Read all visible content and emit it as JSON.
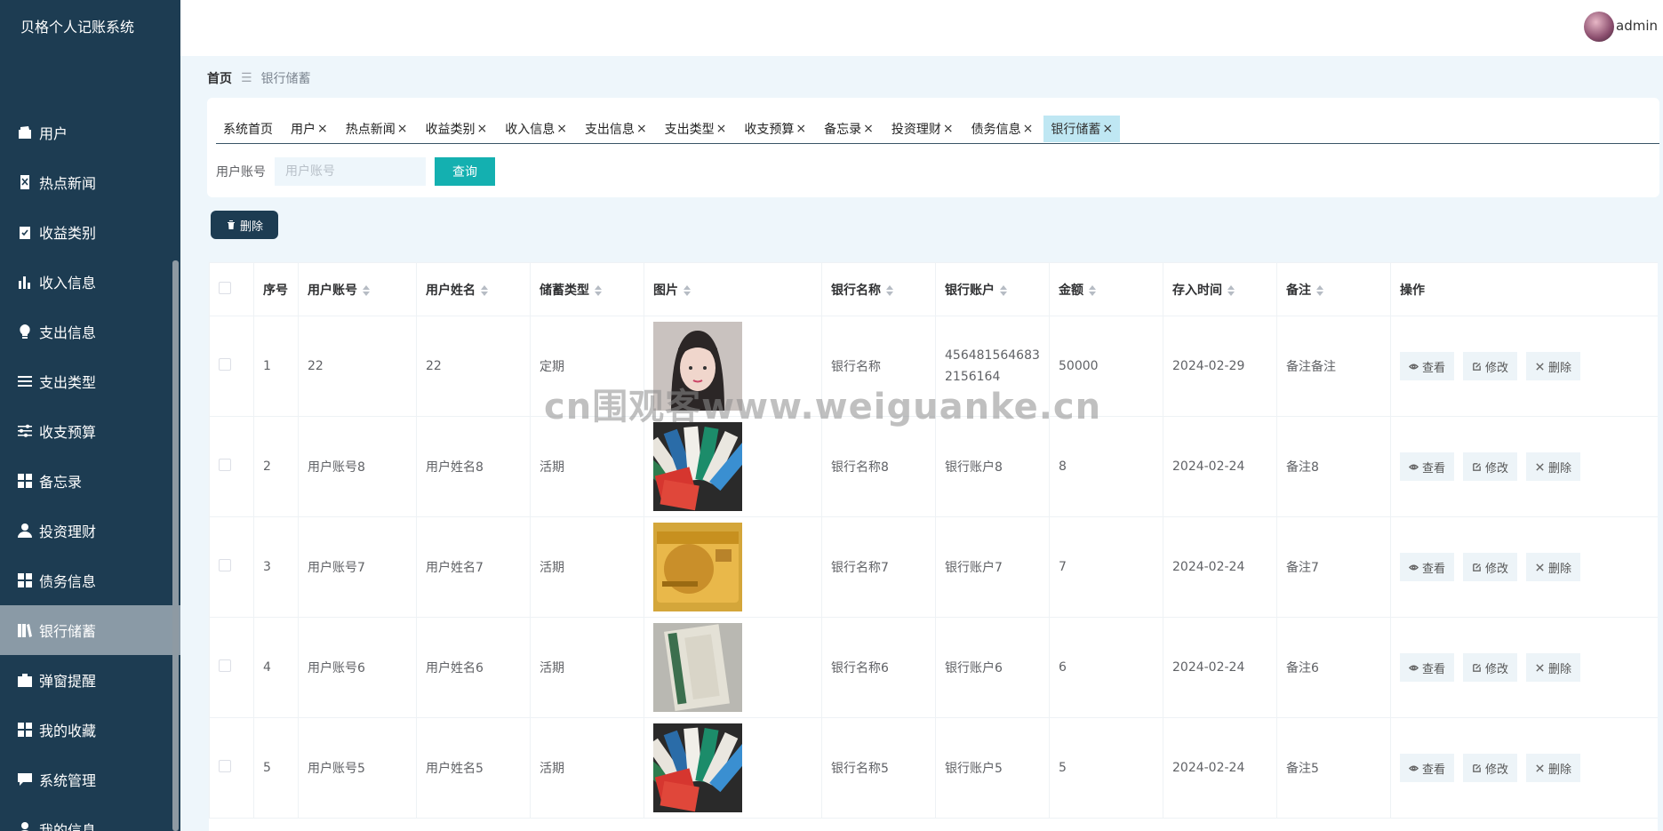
{
  "app": {
    "title": "贝格个人记账系统"
  },
  "user": {
    "name": "admin"
  },
  "sidebar": {
    "items": [
      {
        "label": "用户",
        "icon": "wallet-icon"
      },
      {
        "label": "热点新闻",
        "icon": "document-x-icon"
      },
      {
        "label": "收益类别",
        "icon": "clipboard-check-icon"
      },
      {
        "label": "收入信息",
        "icon": "bar-chart-icon"
      },
      {
        "label": "支出信息",
        "icon": "lightbulb-icon"
      },
      {
        "label": "支出类型",
        "icon": "list-icon"
      },
      {
        "label": "收支预算",
        "icon": "sliders-icon"
      },
      {
        "label": "备忘录",
        "icon": "grid-icon"
      },
      {
        "label": "投资理财",
        "icon": "user-icon"
      },
      {
        "label": "债务信息",
        "icon": "grid-icon"
      },
      {
        "label": "银行储蓄",
        "icon": "book-icon",
        "active": true
      },
      {
        "label": "弹窗提醒",
        "icon": "briefcase-icon"
      },
      {
        "label": "我的收藏",
        "icon": "grid-icon"
      },
      {
        "label": "系统管理",
        "icon": "chat-icon"
      },
      {
        "label": "我的信息",
        "icon": "user-icon"
      }
    ]
  },
  "breadcrumb": {
    "home": "首页",
    "current": "银行储蓄"
  },
  "tabs": [
    {
      "label": "系统首页",
      "closable": false
    },
    {
      "label": "用户",
      "closable": true
    },
    {
      "label": "热点新闻",
      "closable": true
    },
    {
      "label": "收益类别",
      "closable": true
    },
    {
      "label": "收入信息",
      "closable": true
    },
    {
      "label": "支出信息",
      "closable": true
    },
    {
      "label": "支出类型",
      "closable": true
    },
    {
      "label": "收支预算",
      "closable": true
    },
    {
      "label": "备忘录",
      "closable": true
    },
    {
      "label": "投资理财",
      "closable": true
    },
    {
      "label": "债务信息",
      "closable": true
    },
    {
      "label": "银行储蓄",
      "closable": true,
      "active": true
    }
  ],
  "tab_close_glyph": "×",
  "search": {
    "label": "用户账号",
    "placeholder": "用户账号",
    "value": "",
    "button": "查询"
  },
  "toolbar": {
    "delete_label": "删除"
  },
  "table": {
    "columns": [
      "序号",
      "用户账号",
      "用户姓名",
      "储蓄类型",
      "图片",
      "银行名称",
      "银行账户",
      "金额",
      "存入时间",
      "备注",
      "操作"
    ],
    "actions": {
      "view": "查看",
      "edit": "修改",
      "delete": "删除"
    },
    "rows": [
      {
        "index": "1",
        "account": "22",
        "name": "22",
        "type": "定期",
        "image": "portrait-photo",
        "bank": "银行名称",
        "bank_account": "4564815646832156164",
        "amount": "50000",
        "date": "2024-02-29",
        "note": "备注备注"
      },
      {
        "index": "2",
        "account": "用户账号8",
        "name": "用户姓名8",
        "type": "活期",
        "image": "cards-fan-photo",
        "bank": "银行名称8",
        "bank_account": "银行账户8",
        "amount": "8",
        "date": "2024-02-24",
        "note": "备注8"
      },
      {
        "index": "3",
        "account": "用户账号7",
        "name": "用户姓名7",
        "type": "活期",
        "image": "gold-card-photo",
        "bank": "银行名称7",
        "bank_account": "银行账户7",
        "amount": "7",
        "date": "2024-02-24",
        "note": "备注7"
      },
      {
        "index": "4",
        "account": "用户账号6",
        "name": "用户姓名6",
        "type": "活期",
        "image": "card-edge-photo",
        "bank": "银行名称6",
        "bank_account": "银行账户6",
        "amount": "6",
        "date": "2024-02-24",
        "note": "备注6"
      },
      {
        "index": "5",
        "account": "用户账号5",
        "name": "用户姓名5",
        "type": "活期",
        "image": "cards-fan-photo",
        "bank": "银行名称5",
        "bank_account": "银行账户5",
        "amount": "5",
        "date": "2024-02-24",
        "note": "备注5"
      }
    ]
  },
  "watermark": "cn围观客www.weiguanke.cn"
}
